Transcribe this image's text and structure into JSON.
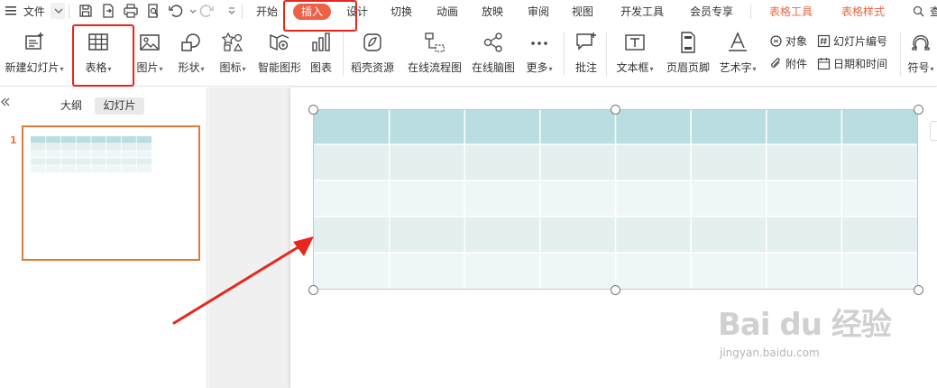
{
  "menubar": {
    "menu_label": "文件",
    "tabs": [
      {
        "label": "开始"
      },
      {
        "label": "插入"
      },
      {
        "label": "设计"
      },
      {
        "label": "切换"
      },
      {
        "label": "动画"
      },
      {
        "label": "放映"
      },
      {
        "label": "审阅"
      },
      {
        "label": "视图"
      },
      {
        "label": "开发工具"
      },
      {
        "label": "会员专享"
      },
      {
        "label": "表格工具"
      },
      {
        "label": "表格样式"
      }
    ],
    "search_label": "查找",
    "active_tab_color": "#ef6144",
    "context_tab_color": "#e8663f"
  },
  "ribbon": {
    "items": [
      {
        "label": "新建幻灯片",
        "icon": "new-slide-icon"
      },
      {
        "label": "表格",
        "icon": "table-grid-icon"
      },
      {
        "label": "图片",
        "icon": "picture-icon"
      },
      {
        "label": "形状",
        "icon": "shapes-icon"
      },
      {
        "label": "图标",
        "icon": "icons-library-icon"
      },
      {
        "label": "智能图形",
        "icon": "smart-graphic-icon"
      },
      {
        "label": "图表",
        "icon": "chart-icon"
      },
      {
        "label": "稻壳资源",
        "icon": "docer-resource-icon"
      },
      {
        "label": "在线流程图",
        "icon": "flowchart-icon"
      },
      {
        "label": "在线脑图",
        "icon": "mindmap-icon"
      },
      {
        "label": "更多",
        "icon": "more-dots-icon"
      },
      {
        "label": "批注",
        "icon": "comment-icon"
      },
      {
        "label": "文本框",
        "icon": "textbox-icon"
      },
      {
        "label": "页眉页脚",
        "icon": "header-footer-icon"
      },
      {
        "label": "艺术字",
        "icon": "wordart-icon"
      },
      {
        "label": "符号",
        "icon": "symbol-omega-icon"
      }
    ],
    "small_items": [
      {
        "label": "对象",
        "icon": "object-icon"
      },
      {
        "label": "幻灯片编号",
        "icon": "slide-number-icon"
      },
      {
        "label": "附件",
        "icon": "attachment-icon"
      },
      {
        "label": "日期和时间",
        "icon": "calendar-icon"
      }
    ]
  },
  "left_pane": {
    "tabs": [
      {
        "label": "大纲"
      },
      {
        "label": "幻灯片"
      }
    ],
    "slide_number": "1"
  },
  "table": {
    "rows": 5,
    "cols": 8,
    "header_color": "#b9dde0",
    "band_color_dark": "#e4eff0",
    "band_color_light": "#eff6f7"
  },
  "annotations": {
    "highlight_color": "#e8261b",
    "highlighted": [
      "插入",
      "表格"
    ]
  },
  "watermark": {
    "logo_text": "Bai du 经验",
    "url_text": "jingyan.baidu.com"
  }
}
